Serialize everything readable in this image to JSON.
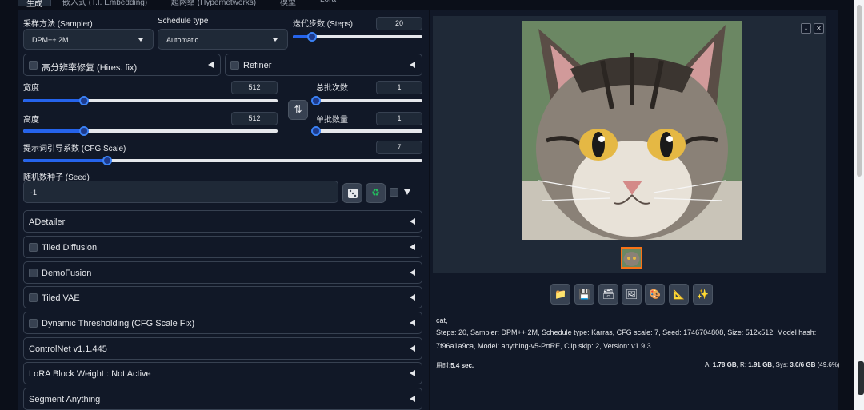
{
  "tabs": [
    {
      "label": "生成",
      "active": true
    },
    {
      "label": "嵌入式 (T.I. Embedding)",
      "active": false
    },
    {
      "label": "超网络 (Hypernetworks)",
      "active": false
    },
    {
      "label": "模型",
      "active": false
    },
    {
      "label": "Lora",
      "active": false
    }
  ],
  "sampler": {
    "label": "采样方法 (Sampler)",
    "value": "DPM++ 2M"
  },
  "schedule": {
    "label": "Schedule type",
    "value": "Automatic"
  },
  "steps": {
    "label": "迭代步数 (Steps)",
    "value": "20",
    "fraction": 0.15
  },
  "hires": {
    "label": "高分辨率修复 (Hires. fix)"
  },
  "refiner": {
    "label": "Refiner"
  },
  "width": {
    "label": "宽度",
    "value": "512",
    "fraction": 0.24
  },
  "height": {
    "label": "高度",
    "value": "512",
    "fraction": 0.24
  },
  "batch_count": {
    "label": "总批次数",
    "value": "1",
    "fraction": 0.0
  },
  "batch_size": {
    "label": "单批数量",
    "value": "1",
    "fraction": 0.0
  },
  "swap_icon": "swap-arrows-icon",
  "cfg": {
    "label": "提示词引导系数 (CFG Scale)",
    "value": "7",
    "fraction": 0.21
  },
  "seed": {
    "label": "随机数种子 (Seed)",
    "value": "-1"
  },
  "accordions": [
    {
      "label": "ADetailer",
      "checkbox": false
    },
    {
      "label": "Tiled Diffusion",
      "checkbox": true
    },
    {
      "label": "DemoFusion",
      "checkbox": true
    },
    {
      "label": "Tiled VAE",
      "checkbox": true
    },
    {
      "label": "Dynamic Thresholding (CFG Scale Fix)",
      "checkbox": true
    },
    {
      "label": "ControlNet v1.1.445",
      "checkbox": false
    },
    {
      "label": "LoRA Block Weight : Not Active",
      "checkbox": false
    },
    {
      "label": "Segment Anything",
      "checkbox": false
    }
  ],
  "tools": [
    "folder-icon",
    "save-icon",
    "zip-icon",
    "image-icon",
    "palette-icon",
    "ruler-icon",
    "sparkle-icon"
  ],
  "output": {
    "prompt": "cat,",
    "params_line1": "Steps: 20, Sampler: DPM++ 2M, Schedule type: Karras, CFG scale: 7, Seed: 1746704808, Size: 512x512, Model hash:",
    "params_line2": "7f96a1a9ca, Model: anything-v5-PrtRE, Clip skip: 2, Version: v1.9.3",
    "time_label": "用时:",
    "time_value": "5.4 sec.",
    "mem_a_label": "A:",
    "mem_a": "1.78 GB",
    "mem_r_label": ", R:",
    "mem_r": "1.91 GB",
    "mem_sys_label": ", Sys:",
    "mem_sys": "3.0/6 GB",
    "mem_pct": "(49.6%)"
  },
  "colors": {
    "accent": "#2563eb",
    "bg": "#0b0f19",
    "panel": "#111827",
    "thumb_border": "#f97316"
  }
}
